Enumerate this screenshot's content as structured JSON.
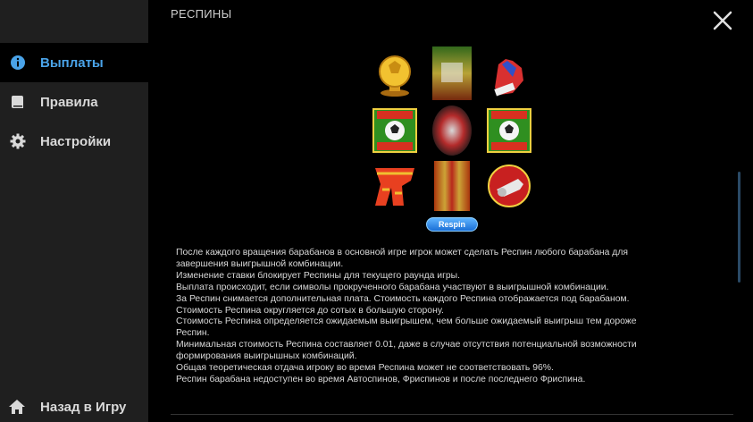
{
  "sidebar": {
    "items": [
      {
        "label": "Выплаты",
        "icon": "info-icon",
        "active": true
      },
      {
        "label": "Правила",
        "icon": "book-icon",
        "active": false
      },
      {
        "label": "Настройки",
        "icon": "gear-icon",
        "active": false
      }
    ],
    "back_label": "Назад в Игру",
    "back_icon": "home-icon"
  },
  "main": {
    "section_title": "РЕСПИНЫ",
    "close_icon": "close-icon",
    "reels": {
      "symbols": [
        [
          "golden-ball-trophy",
          "blurred-reel",
          "goalkeeper-glove"
        ],
        [
          "goal-scatter",
          "blurred-reel",
          "goal-scatter"
        ],
        [
          "fan-scarf",
          "blurred-reel",
          "referee-whistle"
        ]
      ]
    },
    "respin_label": "Respin",
    "description": [
      "После каждого вращения барабанов в основной игре игрок может сделать Респин любого барабана для",
      "завершения выигрышной комбинации.",
      "Изменение ставки блокирует Респины для текущего раунда игры.",
      "Выплата происходит, если символы прокрученного барабана участвуют в выигрышной комбинации.",
      "За Респин снимается дополнительная плата. Стоимость каждого Респина отображается под барабаном.",
      "Стоимость Респина округляется до сотых в большую сторону.",
      "Стоимость Респина определяется ожидаемым выигрышем, чем больше ожидаемый выигрыш тем дороже",
      "Респин.",
      "Минимальная стоимость Респина составляет 0.01, даже в случае отсутствия потенциальной возможности",
      "формирования выигрышных комбинаций.",
      "Общая теоретическая отдача игроку во время Респина может не соответствовать 96%.",
      "Респин барабана недоступен во время Автоспинов, Фриспинов и после последнего Фриспина."
    ]
  },
  "colors": {
    "accent": "#4aa3e8",
    "sidebar_bg": "#1f1f1f",
    "main_bg": "#000000",
    "respin_button": "#1a6fd6"
  }
}
